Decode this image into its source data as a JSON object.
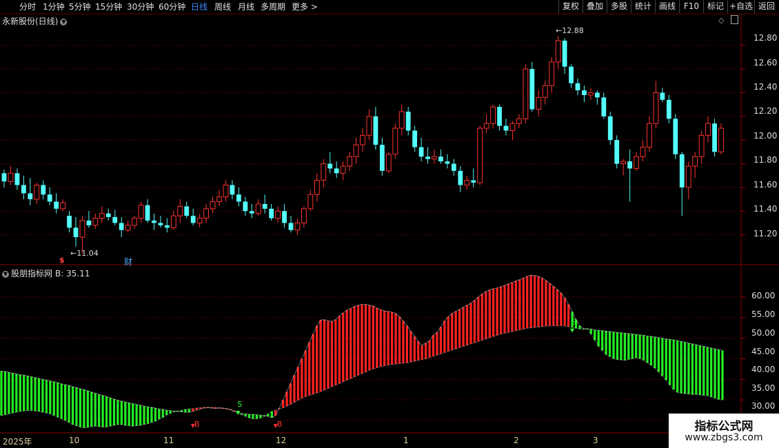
{
  "toolbar": {
    "left": [
      "分时",
      "1分钟",
      "5分钟",
      "15分钟",
      "30分钟",
      "60分钟",
      "日线",
      "周线",
      "月线",
      "多周期",
      "更多 >"
    ],
    "active": "日线",
    "right": [
      "复权",
      "叠加",
      "多股",
      "统计",
      "画线",
      "F10",
      "标记",
      "+自选",
      "返回"
    ]
  },
  "stock_title": "永新股份(日线)",
  "indicator": {
    "name": "股朋指标网",
    "b_label": "B: 35.11"
  },
  "price_axis": [
    "12.80",
    "12.60",
    "12.40",
    "12.20",
    "12.00",
    "11.80",
    "11.60",
    "11.40",
    "11.20"
  ],
  "indicator_axis": [
    "60.00",
    "55.00",
    "50.00",
    "45.00",
    "40.00",
    "35.00",
    "30.00"
  ],
  "dates": [
    "2025年",
    "10",
    "11",
    "12",
    "1",
    "2",
    "3"
  ],
  "annotations": {
    "high": "12.88",
    "low": "11.04",
    "cai": "财",
    "s_label": "S",
    "b_label": "B"
  },
  "watermark": {
    "line1": "指标公式网",
    "line2": "www.zbgs3.com"
  },
  "colors": {
    "up": "#ff3232",
    "down": "#54fcfc",
    "bull": "#ff2020",
    "bear": "#22ee22",
    "grid": "#5a0000"
  },
  "chart_data": [
    {
      "type": "candlestick",
      "title": "永新股份(日线)",
      "ylim": [
        11.0,
        12.95
      ],
      "y_ticks": [
        11.2,
        11.4,
        11.6,
        11.8,
        12.0,
        12.2,
        12.4,
        12.6,
        12.8
      ],
      "annotations": {
        "max": 12.88,
        "min": 11.04
      },
      "ohlc": [
        [
          11.72,
          11.75,
          11.6,
          11.65
        ],
        [
          11.65,
          11.78,
          11.62,
          11.72
        ],
        [
          11.72,
          11.76,
          11.58,
          11.62
        ],
        [
          11.62,
          11.7,
          11.5,
          11.55
        ],
        [
          11.55,
          11.68,
          11.45,
          11.5
        ],
        [
          11.5,
          11.64,
          11.46,
          11.62
        ],
        [
          11.62,
          11.66,
          11.5,
          11.54
        ],
        [
          11.54,
          11.6,
          11.45,
          11.48
        ],
        [
          11.48,
          11.55,
          11.38,
          11.42
        ],
        [
          11.42,
          11.5,
          11.4,
          11.47
        ],
        [
          11.36,
          11.4,
          11.22,
          11.26
        ],
        [
          11.26,
          11.35,
          11.1,
          11.18
        ],
        [
          11.18,
          11.36,
          11.04,
          11.32
        ],
        [
          11.32,
          11.4,
          11.26,
          11.28
        ],
        [
          11.28,
          11.38,
          11.25,
          11.34
        ],
        [
          11.34,
          11.44,
          11.3,
          11.38
        ],
        [
          11.38,
          11.42,
          11.32,
          11.35
        ],
        [
          11.35,
          11.41,
          11.28,
          11.3
        ],
        [
          11.3,
          11.35,
          11.18,
          11.24
        ],
        [
          11.24,
          11.32,
          11.22,
          11.28
        ],
        [
          11.28,
          11.36,
          11.25,
          11.34
        ],
        [
          11.34,
          11.48,
          11.3,
          11.45
        ],
        [
          11.45,
          11.5,
          11.3,
          11.32
        ],
        [
          11.32,
          11.38,
          11.24,
          11.3
        ],
        [
          11.3,
          11.36,
          11.26,
          11.28
        ],
        [
          11.28,
          11.34,
          11.22,
          11.26
        ],
        [
          11.26,
          11.4,
          11.24,
          11.36
        ],
        [
          11.36,
          11.5,
          11.3,
          11.44
        ],
        [
          11.44,
          11.48,
          11.34,
          11.36
        ],
        [
          11.36,
          11.42,
          11.28,
          11.3
        ],
        [
          11.3,
          11.38,
          11.26,
          11.34
        ],
        [
          11.34,
          11.46,
          11.3,
          11.42
        ],
        [
          11.42,
          11.52,
          11.38,
          11.48
        ],
        [
          11.48,
          11.58,
          11.44,
          11.52
        ],
        [
          11.52,
          11.66,
          11.48,
          11.62
        ],
        [
          11.62,
          11.66,
          11.5,
          11.54
        ],
        [
          11.54,
          11.6,
          11.44,
          11.48
        ],
        [
          11.48,
          11.52,
          11.36,
          11.4
        ],
        [
          11.4,
          11.46,
          11.34,
          11.38
        ],
        [
          11.38,
          11.5,
          11.36,
          11.46
        ],
        [
          11.46,
          11.54,
          11.38,
          11.42
        ],
        [
          11.42,
          11.46,
          11.32,
          11.34
        ],
        [
          11.34,
          11.44,
          11.3,
          11.4
        ],
        [
          11.4,
          11.46,
          11.26,
          11.3
        ],
        [
          11.3,
          11.36,
          11.22,
          11.24
        ],
        [
          11.24,
          11.34,
          11.2,
          11.3
        ],
        [
          11.3,
          11.44,
          11.26,
          11.42
        ],
        [
          11.42,
          11.58,
          11.4,
          11.54
        ],
        [
          11.54,
          11.72,
          11.48,
          11.66
        ],
        [
          11.66,
          11.84,
          11.6,
          11.8
        ],
        [
          11.8,
          11.9,
          11.72,
          11.76
        ],
        [
          11.76,
          11.82,
          11.68,
          11.72
        ],
        [
          11.72,
          11.82,
          11.66,
          11.78
        ],
        [
          11.78,
          11.9,
          11.74,
          11.86
        ],
        [
          11.86,
          12.02,
          11.8,
          11.96
        ],
        [
          11.96,
          12.1,
          11.9,
          12.04
        ],
        [
          12.04,
          12.26,
          12.0,
          12.2
        ],
        [
          12.2,
          12.28,
          11.92,
          11.96
        ],
        [
          11.96,
          12.02,
          11.7,
          11.74
        ],
        [
          11.74,
          11.9,
          11.72,
          11.88
        ],
        [
          11.88,
          12.14,
          11.84,
          12.1
        ],
        [
          12.1,
          12.3,
          12.04,
          12.24
        ],
        [
          12.24,
          12.28,
          12.04,
          12.08
        ],
        [
          12.08,
          12.12,
          11.9,
          11.94
        ],
        [
          11.94,
          12.02,
          11.82,
          11.86
        ],
        [
          11.86,
          11.94,
          11.8,
          11.84
        ],
        [
          11.84,
          11.92,
          11.8,
          11.86
        ],
        [
          11.86,
          11.92,
          11.8,
          11.82
        ],
        [
          11.82,
          11.88,
          11.76,
          11.8
        ],
        [
          11.8,
          11.84,
          11.7,
          11.74
        ],
        [
          11.74,
          11.78,
          11.56,
          11.62
        ],
        [
          11.62,
          11.7,
          11.58,
          11.66
        ],
        [
          11.66,
          11.76,
          11.6,
          11.64
        ],
        [
          11.64,
          12.12,
          11.62,
          12.1
        ],
        [
          12.1,
          12.22,
          12.06,
          12.14
        ],
        [
          12.14,
          12.3,
          12.1,
          12.28
        ],
        [
          12.28,
          12.3,
          12.08,
          12.12
        ],
        [
          12.12,
          12.18,
          12.04,
          12.08
        ],
        [
          12.08,
          12.16,
          12.0,
          12.14
        ],
        [
          12.14,
          12.22,
          12.1,
          12.18
        ],
        [
          12.18,
          12.64,
          12.14,
          12.6
        ],
        [
          12.6,
          12.66,
          12.24,
          12.26
        ],
        [
          12.26,
          12.42,
          12.2,
          12.36
        ],
        [
          12.36,
          12.5,
          12.3,
          12.46
        ],
        [
          12.46,
          12.7,
          12.4,
          12.66
        ],
        [
          12.66,
          12.88,
          12.6,
          12.84
        ],
        [
          12.84,
          12.86,
          12.56,
          12.62
        ],
        [
          12.62,
          12.64,
          12.44,
          12.48
        ],
        [
          12.48,
          12.52,
          12.38,
          12.42
        ],
        [
          12.42,
          12.46,
          12.32,
          12.38
        ],
        [
          12.38,
          12.44,
          12.34,
          12.4
        ],
        [
          12.4,
          12.42,
          12.3,
          12.36
        ],
        [
          12.36,
          12.4,
          12.18,
          12.2
        ],
        [
          12.2,
          12.24,
          11.96,
          12.0
        ],
        [
          12.0,
          12.04,
          11.76,
          11.8
        ],
        [
          11.8,
          11.84,
          11.7,
          11.82
        ],
        [
          11.82,
          11.92,
          11.48,
          11.76
        ],
        [
          11.76,
          11.9,
          11.74,
          11.86
        ],
        [
          11.86,
          12.0,
          11.82,
          11.94
        ],
        [
          11.94,
          12.2,
          11.9,
          12.14
        ],
        [
          12.14,
          12.5,
          12.1,
          12.4
        ],
        [
          12.4,
          12.44,
          12.32,
          12.34
        ],
        [
          12.34,
          12.38,
          12.14,
          12.18
        ],
        [
          12.18,
          12.22,
          11.84,
          11.88
        ],
        [
          11.88,
          11.9,
          11.36,
          11.6
        ],
        [
          11.6,
          11.82,
          11.5,
          11.78
        ],
        [
          11.78,
          11.9,
          11.68,
          11.86
        ],
        [
          11.86,
          12.08,
          11.8,
          12.04
        ],
        [
          12.04,
          12.2,
          11.98,
          12.14
        ],
        [
          12.14,
          12.18,
          11.86,
          11.9
        ],
        [
          11.9,
          12.14,
          11.88,
          12.1
        ]
      ]
    },
    {
      "type": "bar",
      "title": "股朋指标网",
      "ylim": [
        28,
        66
      ],
      "y_ticks": [
        30,
        35,
        40,
        45,
        50,
        55,
        60
      ],
      "legend": "B: 35.11",
      "annotations": [
        {
          "label": "B",
          "index": 51,
          "value": 30.5
        },
        {
          "label": "S",
          "index": 63,
          "value": 32.0
        },
        {
          "label": "B",
          "index": 73,
          "value": 30.5
        },
        {
          "label": "S",
          "index": 152,
          "value": 52.0
        }
      ],
      "series": [
        {
          "name": "upper",
          "values": [
            42.0,
            41.9,
            41.7,
            41.5,
            41.3,
            41.1,
            41.0,
            40.8,
            40.6,
            40.4,
            40.2,
            40.0,
            39.8,
            39.6,
            39.4,
            39.2,
            38.9,
            38.7,
            38.5,
            38.2,
            38.0,
            37.7,
            37.5,
            37.2,
            36.9,
            36.6,
            36.3,
            36.1,
            35.8,
            35.5,
            35.2,
            34.9,
            34.7,
            34.5,
            34.3,
            34.1,
            33.9,
            33.7,
            33.5,
            33.3,
            33.2,
            33.0,
            32.8,
            32.7,
            32.5,
            32.4,
            32.3,
            32.2,
            32.1,
            32.0,
            32.0,
            32.2,
            32.5,
            32.8,
            33.0,
            33.1,
            33.0,
            32.9,
            33.0,
            33.0,
            32.8,
            32.6,
            32.2,
            31.9,
            31.7,
            31.6,
            31.5,
            31.5,
            31.4,
            31.3,
            31.2,
            31.0,
            30.7,
            31.2,
            33.0,
            35.0,
            37.0,
            39.0,
            41.0,
            43.0,
            45.0,
            47.0,
            49.0,
            51.0,
            53.0,
            54.4,
            54.5,
            54.2,
            54.1,
            54.5,
            55.4,
            56.1,
            56.8,
            57.2,
            57.7,
            58.0,
            58.2,
            58.2,
            58.0,
            57.8,
            57.3,
            56.9,
            56.6,
            56.5,
            56.3,
            56.0,
            55.2,
            54.2,
            53.0,
            51.7,
            50.4,
            49.2,
            48.2,
            48.8,
            49.4,
            50.7,
            51.4,
            52.7,
            54.2,
            55.2,
            56.0,
            56.5,
            57.0,
            57.5,
            58.0,
            58.5,
            59.2,
            60.0,
            60.7,
            61.3,
            61.7,
            62.0,
            62.2,
            62.5,
            62.8,
            63.2,
            63.5,
            63.9,
            64.2,
            64.6,
            65.0,
            65.3,
            65.2,
            65.0,
            64.6,
            64.0,
            63.3,
            62.6,
            61.8,
            61.0,
            59.8,
            58.2,
            56.4,
            54.5,
            53.0,
            52.3,
            52.3
          ]
        },
        {
          "name": "lower",
          "values": [
            31.2,
            31.4,
            31.6,
            31.8,
            32.0,
            32.2,
            32.3,
            32.4,
            32.4,
            32.3,
            32.2,
            32.0,
            31.8,
            31.6,
            31.2,
            30.8,
            30.4,
            30.0,
            29.5,
            29.0,
            28.7,
            28.4,
            28.2,
            28.3,
            28.5,
            28.6,
            28.5,
            28.4,
            28.4,
            28.6,
            28.8,
            29.0,
            29.0,
            28.8,
            28.7,
            28.6,
            28.7,
            28.8,
            29.0,
            29.2,
            29.5,
            29.8,
            30.3,
            30.7,
            31.3,
            31.7,
            32.1,
            32.3,
            32.5,
            32.7,
            32.8,
            32.9,
            33.0,
            33.1,
            33.2,
            33.2,
            33.2,
            33.2,
            33.1,
            33.0,
            32.9,
            32.7,
            32.4,
            31.9,
            31.4,
            31.0,
            30.6,
            30.4,
            30.4,
            30.6,
            31.0,
            31.6,
            32.2,
            32.5,
            32.8,
            33.1,
            33.5,
            33.9,
            34.4,
            34.9,
            35.4,
            35.8,
            36.1,
            36.4,
            36.7,
            37.0,
            37.4,
            37.8,
            38.2,
            38.6,
            39.0,
            39.4,
            39.8,
            40.2,
            40.6,
            41.0,
            41.4,
            41.8,
            42.2,
            42.5,
            42.8,
            43.1,
            43.3,
            43.5,
            43.6,
            43.7,
            43.8,
            43.9,
            44.0,
            44.2,
            44.4,
            44.6,
            44.8,
            45.0,
            45.3,
            45.6,
            45.9,
            46.2,
            46.5,
            46.8,
            47.1,
            47.4,
            47.7,
            48.0,
            48.3,
            48.6,
            48.9,
            49.2,
            49.5,
            49.8,
            50.1,
            50.4,
            50.7,
            51.0,
            51.2,
            51.4,
            51.6,
            51.8,
            52.0,
            52.2,
            52.4,
            52.5,
            52.6,
            52.7,
            52.8,
            52.9,
            53.0,
            53.0,
            53.0,
            53.0,
            53.0,
            52.8,
            52.6,
            52.4,
            52.2,
            52.2,
            52.2
          ]
        }
      ],
      "bear_tail_upper": [
        52.2,
        52.0,
        51.9,
        51.8,
        51.7,
        51.6,
        51.5,
        51.4,
        51.3,
        51.2,
        51.1,
        51.0,
        50.9,
        50.8,
        50.7,
        50.5,
        50.4,
        50.3,
        50.1,
        50.0,
        49.8,
        49.7,
        49.6,
        49.4,
        49.2,
        49.0,
        48.8,
        48.6,
        48.4,
        48.2,
        48.0,
        47.8,
        47.6,
        47.4,
        47.2,
        47.0
      ],
      "bear_tail_lower": [
        51.0,
        49.5,
        48.0,
        47.0,
        46.0,
        45.5,
        45.0,
        44.8,
        44.7,
        44.6,
        44.8,
        45.0,
        45.2,
        45.0,
        44.6,
        44.0,
        43.4,
        42.7,
        41.8,
        40.8,
        39.8,
        38.6,
        37.5,
        36.8,
        36.6,
        36.5,
        36.4,
        36.3,
        36.3,
        36.2,
        36.1,
        36.0,
        35.7,
        35.4,
        35.1,
        35.0
      ]
    }
  ]
}
